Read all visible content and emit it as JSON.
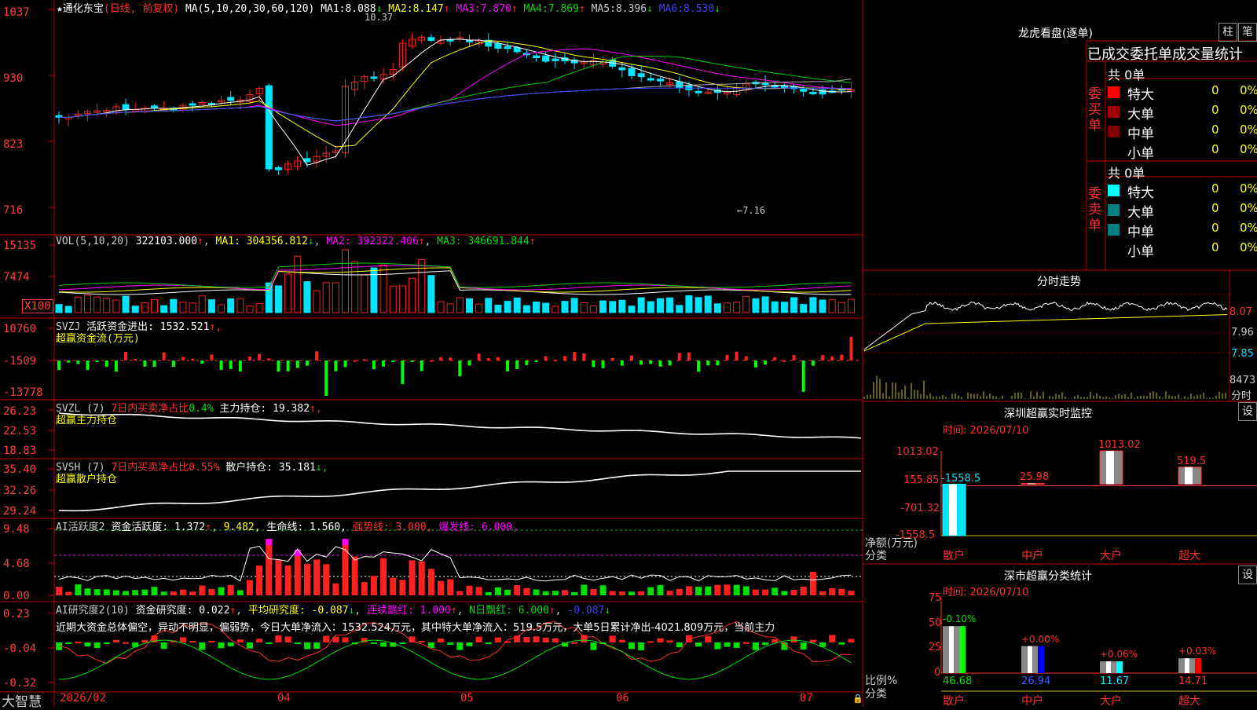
{
  "colors": {
    "up": "#ff2020",
    "down": "#00e5ff",
    "ma1": "#ffffff",
    "ma2": "#ffff00",
    "ma3": "#ff00ff",
    "ma4": "#00d000",
    "ma5": "#b0b0b0",
    "ma6": "#4040ff",
    "axis": "#ff3030"
  },
  "stock": {
    "star": "★",
    "name": "通化东宝",
    "mode": "(日线, 前复权)",
    "ma_param": "MA(5,10,20,30,60,120)",
    "ma": [
      {
        "label": "MA1:",
        "val": "8.088",
        "arrow": "↓"
      },
      {
        "label": "MA2:",
        "val": "8.147",
        "arrow": "↑"
      },
      {
        "label": "MA3:",
        "val": "7.870",
        "arrow": "↑"
      },
      {
        "label": "MA4:",
        "val": "7.869",
        "arrow": "↑"
      },
      {
        "label": "MA5:",
        "val": "8.396",
        "arrow": "↓"
      },
      {
        "label": "MA6:",
        "val": "8.530",
        "arrow": "↓"
      }
    ],
    "high_marker": "10.37",
    "low_marker": "←7.16"
  },
  "main_y": [
    "1037",
    "930",
    "823",
    "716"
  ],
  "vol": {
    "title": "VOL(5,10,20)",
    "val": "322103.000",
    "arrow": "↑",
    "ma1": "MA1: 304356.812",
    "ma1a": "↓",
    "ma2": "MA2: 392322.406",
    "ma2a": "↑",
    "ma3": "MA3: 346691.844",
    "ma3a": "↑",
    "y": [
      "15135",
      "7474",
      "X100"
    ]
  },
  "svzj": {
    "title": "SVZJ",
    "label": "活跃资金进出:",
    "val": "1532.521",
    "arrow": "↑,",
    "sub": "超赢资金流(万元)",
    "y": [
      "10760",
      "-1509",
      "-13778"
    ]
  },
  "svzl": {
    "title": "SVZL (7)",
    "red": "7日内买卖净占比",
    "pct": "0.4%",
    "label": "主力持仓:",
    "val": "19.382",
    "arrow": "↑,",
    "sub": "超赢主力持仓",
    "y": [
      "26.23",
      "22.53",
      "18.83"
    ]
  },
  "svsh": {
    "title": "SVSH (7)",
    "red": "7日内买卖净占比",
    "pct": "0.55%",
    "label": "散户持仓:",
    "val": "35.181",
    "arrow": "↓,",
    "sub": "超赢散户持仓",
    "y": [
      "35.40",
      "32.26",
      "29.24"
    ]
  },
  "ai1": {
    "title": "AI活跃度2",
    "label": "资金活跃度:",
    "val": "1.372",
    "arrow": "↑",
    "v2": "9.482,",
    "v3": "生命线: 1.560,",
    "v4": "强势线: 3.000,",
    "v5": "爆发线: 6.000,",
    "y": [
      "9.48",
      "4.68",
      "0.00"
    ]
  },
  "ai2": {
    "title": "AI研究度2(10)",
    "label": "资金研究度:",
    "val": "0.022",
    "arrow": "↑",
    "v2": "平均研究度: -0.087",
    "v2a": "↓",
    "v3": "连续飘红: 1.000",
    "v3a": "↑",
    "v4": "N日飘红: 6.000",
    "v4a": "↑",
    "v5": "-0.087",
    "v5a": "↓",
    "commentary": "近期大资金总体偏空，异动不明显，偏弱势，今日大单净流入：1532.524万元，其中特大单净流入：519.5万元，大单5日累计净出-4021.809万元，当前主力",
    "y": [
      "0.23",
      "-0.04",
      "-0.32"
    ]
  },
  "x_axis": [
    "2026/02",
    "04",
    "05",
    "06",
    "07"
  ],
  "brand": "大智慧",
  "lhb": {
    "title": "龙虎看盘(逐单)",
    "btn1": "柱",
    "btn2": "笔",
    "heading": "已成交委托单成交量统计",
    "buy": {
      "side": "委买单",
      "total": "共 0单",
      "rows": [
        {
          "name": "特大",
          "count": "0",
          "pct": "0%",
          "color": "#ff0000"
        },
        {
          "name": "大单",
          "count": "0",
          "pct": "0%",
          "color": "#a00000"
        },
        {
          "name": "中单",
          "count": "0",
          "pct": "0%",
          "color": "#800000"
        },
        {
          "name": "小单",
          "count": "0",
          "pct": "0%",
          "color": "#000000"
        }
      ]
    },
    "sell": {
      "side": "委卖单",
      "total": "共 0单",
      "rows": [
        {
          "name": "特大",
          "count": "0",
          "pct": "0%",
          "color": "#00ffff"
        },
        {
          "name": "大单",
          "count": "0",
          "pct": "0%",
          "color": "#008080"
        },
        {
          "name": "中单",
          "count": "0",
          "pct": "0%",
          "color": "#008080"
        },
        {
          "name": "小单",
          "count": "0",
          "pct": "0%",
          "color": "#000000"
        }
      ]
    }
  },
  "fenshi": {
    "title": "分时走势",
    "y": [
      "8.07",
      "7.96",
      "7.85",
      "8473"
    ],
    "bottom": "分时"
  },
  "sz_monitor": {
    "title": "深圳超赢实时监控",
    "btn": "设",
    "time": "时间: 2026/07/10",
    "unit": "净额(万元)",
    "cat_label": "分类",
    "y": [
      "1013.02",
      "155.85",
      "-701.32",
      "-1558.5"
    ],
    "bars": [
      {
        "cat": "散户",
        "value": -1558.5,
        "label": "-1558.5"
      },
      {
        "cat": "中户",
        "value": 25.98,
        "label": "25.98"
      },
      {
        "cat": "大户",
        "value": 1013.02,
        "label": "1013.02"
      },
      {
        "cat": "超大",
        "value": 519.5,
        "label": "519.5"
      }
    ]
  },
  "sz_class": {
    "title": "深市超赢分类统计",
    "btn": "设",
    "time": "时间: 2026/07/10",
    "unit": "比例%",
    "cat_label": "分类",
    "y": [
      "75",
      "50",
      "25",
      "0"
    ],
    "bars": [
      {
        "cat": "散户",
        "value": 46.68,
        "top": "-0.10%",
        "bottom": "46.68",
        "color": "#00ff00"
      },
      {
        "cat": "中户",
        "value": 26.94,
        "top": "+0.00%",
        "bottom": "26.94",
        "color": "#0000ff"
      },
      {
        "cat": "大户",
        "value": 11.67,
        "top": "+0.06%",
        "bottom": "11.67",
        "color": "#00ffff"
      },
      {
        "cat": "超大",
        "value": 14.71,
        "top": "+0.03%",
        "bottom": "14.71",
        "color": "#ff0000"
      }
    ]
  }
}
